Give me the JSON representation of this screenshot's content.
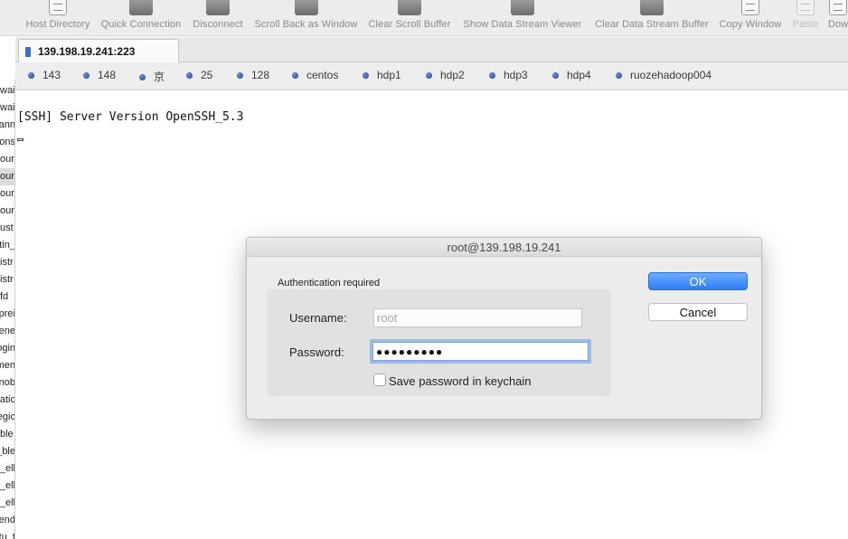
{
  "toolbar": {
    "items": [
      {
        "label": "Host Directory",
        "icon": "host-directory-icon",
        "disabled": false
      },
      {
        "label": "Quick Connection",
        "icon": "quick-connection-icon",
        "disabled": false
      },
      {
        "label": "Disconnect",
        "icon": "disconnect-icon",
        "disabled": false
      },
      {
        "label": "Scroll Back as Window",
        "icon": "scroll-back-icon",
        "disabled": false
      },
      {
        "label": "Clear Scroll Buffer",
        "icon": "clear-scroll-buffer-icon",
        "disabled": false
      },
      {
        "label": "Show Data Stream Viewer",
        "icon": "data-stream-viewer-icon",
        "disabled": false
      },
      {
        "label": "Clear Data Stream Buffer",
        "icon": "clear-data-stream-icon",
        "disabled": false
      },
      {
        "label": "Copy Window",
        "icon": "copy-window-icon",
        "disabled": false
      },
      {
        "label": "Paste",
        "icon": "paste-icon",
        "disabled": true
      },
      {
        "label": "Dow",
        "icon": "download-icon",
        "disabled": false
      }
    ]
  },
  "left_pane": {
    "items": [
      "wai",
      "wai",
      "ann",
      "ons",
      "our",
      "our",
      "our",
      "our",
      "ust",
      "_tin",
      "istr",
      "istr",
      "fd",
      "prei",
      "ene",
      "ogin",
      "men",
      "nob",
      "atic",
      "egic",
      "ble",
      "ble_",
      "ell_",
      "ell_",
      "ell_",
      "end",
      "tu_t"
    ]
  },
  "session_tab": {
    "label": "139.198.19.241:223"
  },
  "bookmarks": [
    "143",
    "148",
    "京",
    "25",
    "128",
    "centos",
    "hdp1",
    "hdp2",
    "hdp3",
    "hdp4",
    "ruozehadoop004"
  ],
  "terminal": {
    "line1": "[SSH] Server Version OpenSSH_5.3"
  },
  "dialog": {
    "title": "root@139.198.19.241",
    "group_label": "Authentication required",
    "username_label": "Username:",
    "username_value": "root",
    "password_label": "Password:",
    "password_value": "●●●●●●●●●",
    "save_password_label": "Save password in keychain",
    "save_password_checked": false,
    "ok_label": "OK",
    "cancel_label": "Cancel"
  },
  "colors": {
    "accent": "#2f7df6",
    "bookmark_dot": "#1c3f8f"
  }
}
